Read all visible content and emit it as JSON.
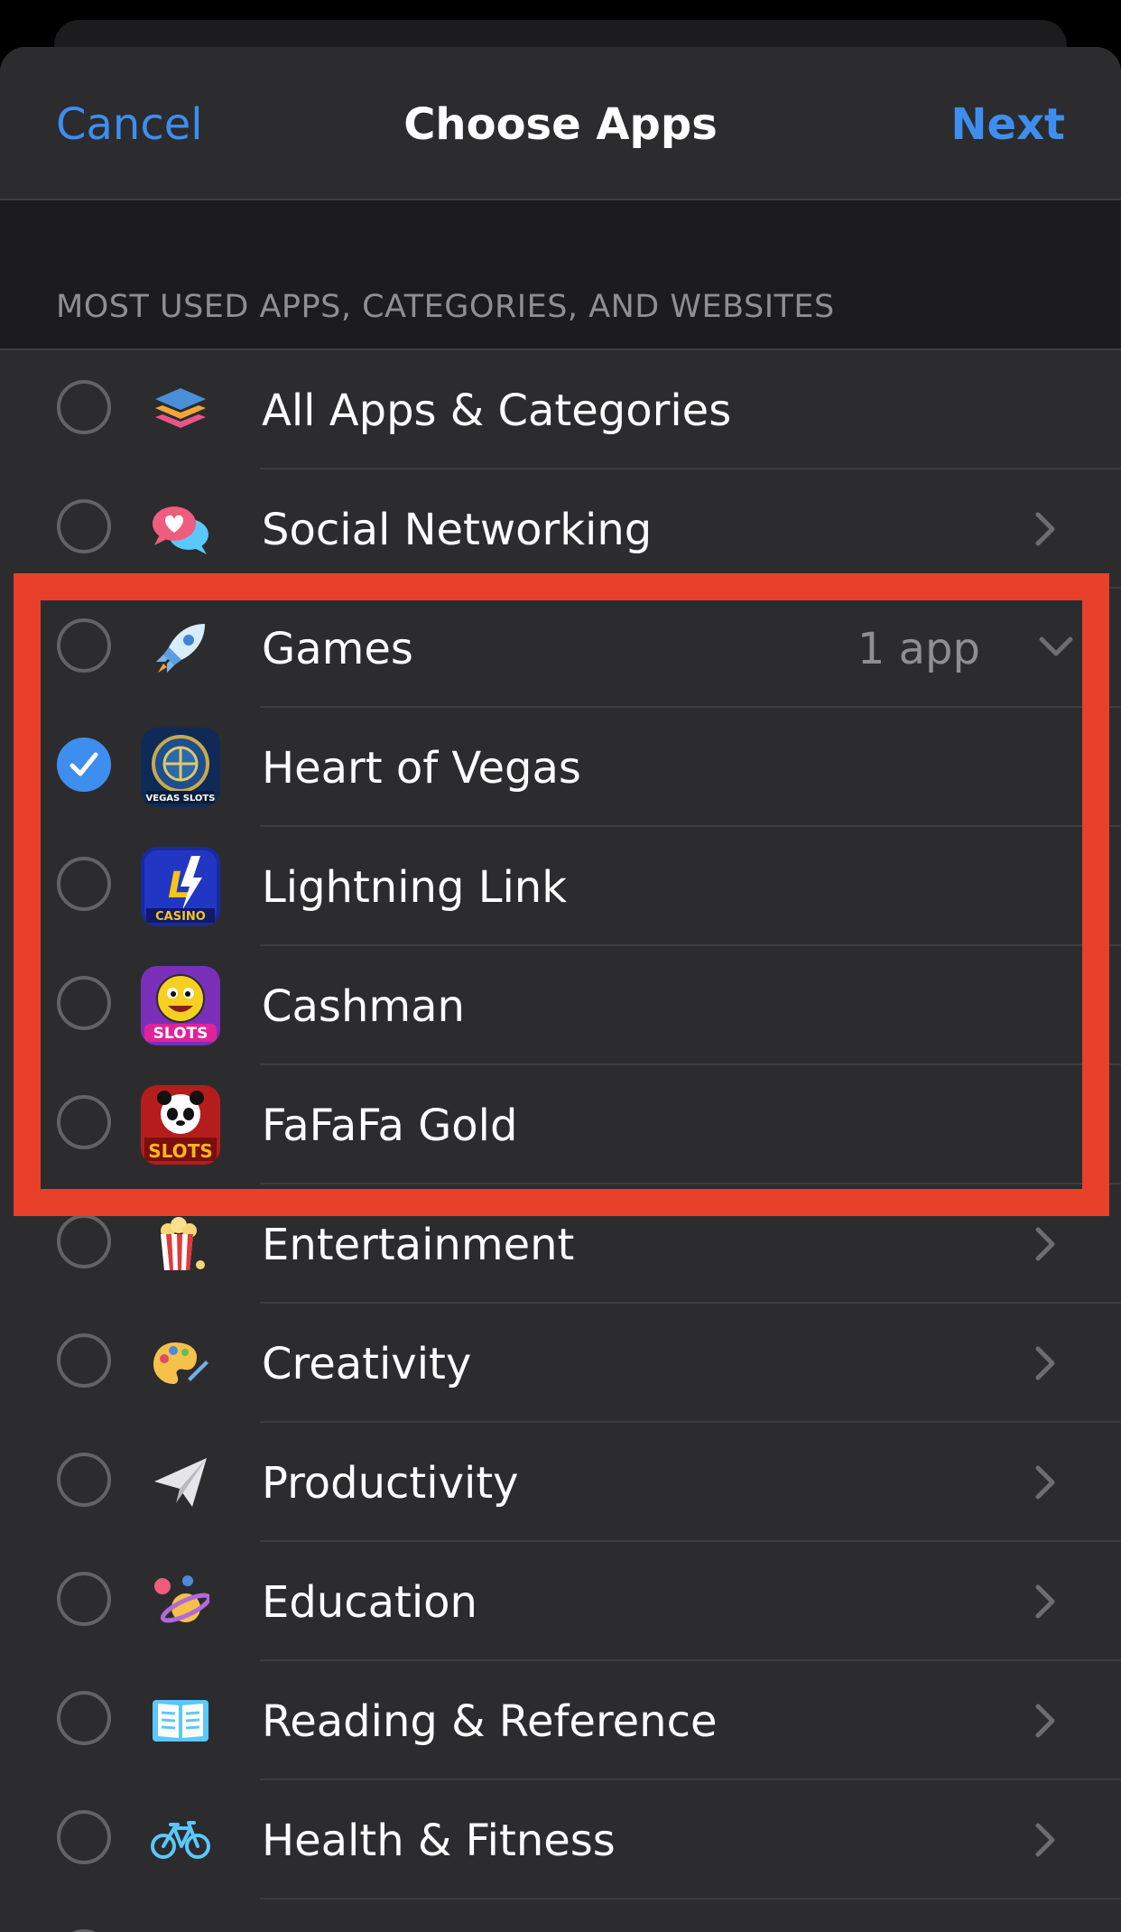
{
  "nav": {
    "cancel": "Cancel",
    "title": "Choose Apps",
    "next": "Next"
  },
  "section": {
    "header": "MOST USED APPS, CATEGORIES, AND WEBSITES"
  },
  "rows": [
    {
      "label": "All Apps & Categories",
      "icon": "stack-layers-icon",
      "checked": false,
      "accessory": "none"
    },
    {
      "label": "Social Networking",
      "icon": "chat-bubbles-heart-icon",
      "checked": false,
      "accessory": "chevron-right"
    },
    {
      "label": "Games",
      "icon": "rocket-icon",
      "checked": false,
      "count": "1 app",
      "accessory": "chevron-down"
    },
    {
      "label": "Heart of Vegas",
      "icon": "heart-of-vegas-app-icon",
      "checked": true,
      "accessory": "none"
    },
    {
      "label": "Lightning Link",
      "icon": "lightning-link-app-icon",
      "checked": false,
      "accessory": "none"
    },
    {
      "label": "Cashman",
      "icon": "cashman-app-icon",
      "checked": false,
      "accessory": "none"
    },
    {
      "label": "FaFaFa Gold",
      "icon": "fafafa-gold-app-icon",
      "checked": false,
      "accessory": "none"
    },
    {
      "label": "Entertainment",
      "icon": "popcorn-icon",
      "checked": false,
      "accessory": "chevron-right"
    },
    {
      "label": "Creativity",
      "icon": "palette-icon",
      "checked": false,
      "accessory": "chevron-right"
    },
    {
      "label": "Productivity",
      "icon": "paper-plane-icon",
      "checked": false,
      "accessory": "chevron-right"
    },
    {
      "label": "Education",
      "icon": "planet-icon",
      "checked": false,
      "accessory": "chevron-right"
    },
    {
      "label": "Reading & Reference",
      "icon": "open-book-icon",
      "checked": false,
      "accessory": "chevron-right"
    },
    {
      "label": "Health & Fitness",
      "icon": "bicycle-icon",
      "checked": false,
      "accessory": "chevron-right"
    }
  ],
  "colors": {
    "accent": "#3e8ef0",
    "highlight": "#e8402a",
    "sheet": "#2c2c2e"
  }
}
